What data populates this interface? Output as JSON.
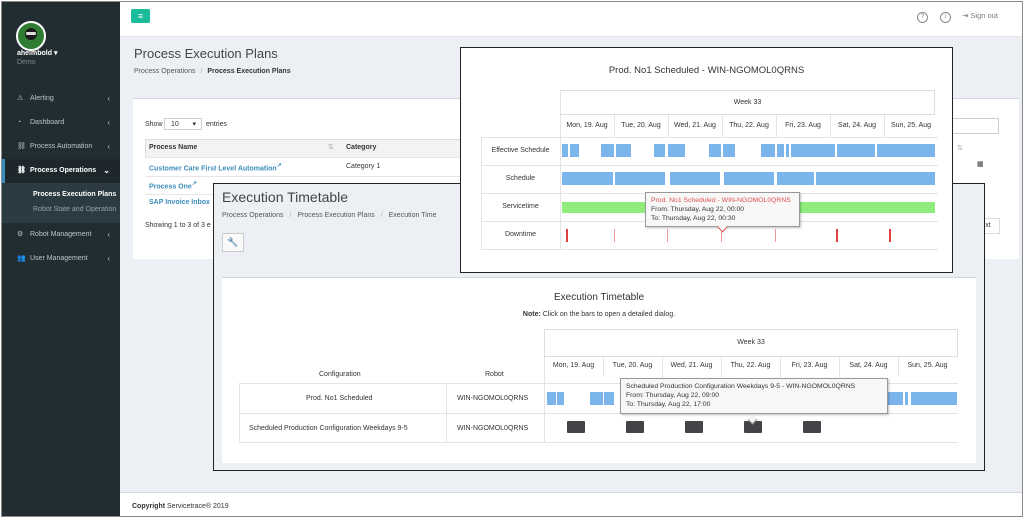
{
  "sidebar": {
    "user": {
      "name": "ahelmbold",
      "caret": "▾",
      "role": "Demo"
    },
    "items": [
      {
        "label": "Alerting",
        "icon": "warning-icon",
        "glyph": "⚠"
      },
      {
        "label": "Dashboard",
        "icon": "dashboard-icon",
        "glyph": "◔"
      },
      {
        "label": "Process Automation",
        "icon": "sitemap-icon",
        "glyph": "⛓"
      },
      {
        "label": "Process Operations",
        "icon": "sitemap-icon",
        "glyph": "⛓",
        "open": true
      },
      {
        "label": "Robot Management",
        "icon": "robot-icon",
        "glyph": "⚙"
      },
      {
        "label": "User Management",
        "icon": "users-icon",
        "glyph": "👥"
      }
    ],
    "subitems": [
      "Process Execution Plans",
      "Robot State and Operation"
    ],
    "chevron_left": "‹",
    "chevron_down": "⌄"
  },
  "topbar": {
    "menu_glyph": "≡",
    "help_glyph": "?",
    "info_glyph": "i",
    "signout_glyph": "⇥",
    "signout": "Sign out"
  },
  "main": {
    "title": "Process Execution Plans",
    "breadcrumb": {
      "parent": "Process Operations",
      "sep": "/",
      "current": "Process Execution Plans"
    },
    "show": "Show",
    "entries_value": "10",
    "entries_arrow": "▾",
    "entries": "entries",
    "columns": [
      "Process Name",
      "Category"
    ],
    "sort_glyph": "⇅",
    "rows": [
      {
        "name": "Customer Care First Level Automation",
        "category": "Category 1"
      },
      {
        "name": "Process One",
        "category": ""
      },
      {
        "name": "SAP Invoice Inbox",
        "category": ""
      }
    ],
    "external_glyph": "↗",
    "showing": "Showing 1 to 3 of 3 e",
    "next": "ext",
    "calendar_glyph": "▦"
  },
  "execution": {
    "title": "Execution Timetable",
    "breadcrumb": [
      "Process Operations",
      "Process Execution Plans",
      "Execution Time"
    ],
    "sep": "/",
    "wrench_glyph": "🔧",
    "chart_title": "Execution Timetable",
    "note_label": "Note:",
    "note": "Click on the bars to open a detailed dialog.",
    "week": "Week 33",
    "days": [
      "Mon, 19. Aug",
      "Tue, 20. Aug",
      "Wed, 21. Aug",
      "Thu, 22. Aug",
      "Fri, 23. Aug",
      "Sat, 24. Aug",
      "Sun, 25. Aug"
    ],
    "col_configuration": "Configuration",
    "col_robot": "Robot",
    "rows": [
      {
        "configuration": "Prod. No1 Scheduled",
        "robot": "WIN-NGOMOL0QRNS"
      },
      {
        "configuration": "Scheduled Production Configuration Weekdays 9-5",
        "robot": "WIN-NGOMOL0QRNS"
      }
    ],
    "tooltip": {
      "title": "Scheduled Production Configuration Weekdays 9-5 - WIN-NGOMOL0QRNS",
      "from": "From: Thursday, Aug 22, 09:00",
      "to": "To: Thursday, Aug 22, 17:00"
    }
  },
  "prod": {
    "title": "Prod. No1 Scheduled - WIN-NGOMOL0QRNS",
    "week": "Week 33",
    "days": [
      "Mon, 19. Aug",
      "Tue, 20. Aug",
      "Wed, 21. Aug",
      "Thu, 22. Aug",
      "Fri, 23. Aug",
      "Sat, 24. Aug",
      "Sun, 25. Aug"
    ],
    "rows": [
      "Effective Schedule",
      "Schedule",
      "Servicetime",
      "Downtime"
    ],
    "tooltip": {
      "title": "Prod. No1 Scheduled - WIN-NGOMOL0QRNS",
      "from": "From: Thursday, Aug 22, 00:00",
      "to": "To: Thursday, Aug 22, 00:30"
    }
  },
  "footer": {
    "label": "Copyright",
    "text": "Servicetrace® 2019"
  },
  "colors": {
    "sidebar": "#222d32",
    "accent": "#1abc9c",
    "link": "#3c8dbc",
    "bar": "#7cb5ec",
    "servicetime": "#90ed7d",
    "downtime": "#e04040",
    "block": "#434348"
  }
}
